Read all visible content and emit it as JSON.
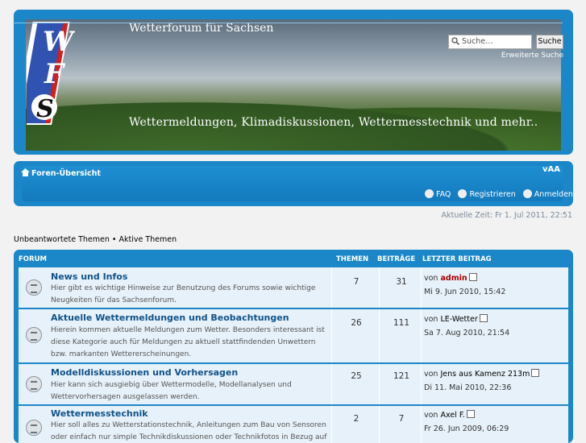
{
  "header": {
    "forum_title": "Wetterforum für Sachsen",
    "tagline": "Wettermeldungen, Klimadiskussionen, Wettermesstechnik und mehr..",
    "search_placeholder": "Suche…",
    "search_button": "Suche",
    "advanced_search": "Erweiterte Suche",
    "logo_letters": "WFS"
  },
  "nav": {
    "forum_index": "Foren-Übersicht",
    "font_size_toggle": "vAA",
    "faq": "FAQ",
    "register": "Registrieren",
    "login": "Anmelden"
  },
  "time": "Aktuelle Zeit: Fr 1. Jul 2011, 22:51",
  "quicklinks": "Unbeantwortete Themen • Aktive Themen",
  "table": {
    "headers": {
      "forum": "FORUM",
      "topics": "THEMEN",
      "posts": "BEITRÄGE",
      "last_post": "LETZTER BEITRAG"
    },
    "rows": [
      {
        "title": "News und Infos",
        "desc": "Hier gibt es wichtige Hinweise zur Benutzung des Forums sowie wichtige Neugkeiten für das Sachsenforum.",
        "topics": "7",
        "posts": "31",
        "by": "von",
        "author": "admin",
        "date": "Mi 9. Jun 2010, 15:42"
      },
      {
        "title": "Aktuelle Wettermeldungen und Beobachtungen",
        "desc": "Hierein kommen aktuelle Meldungen zum Wetter. Besonders interessant ist diese Kategorie auch für Meldungen zu aktuell stattfindenden Unwettern bzw. markanten Wettererscheinungen.",
        "topics": "26",
        "posts": "111",
        "by": "von",
        "author": "LE-Wetter",
        "date": "Sa 7. Aug 2010, 21:54"
      },
      {
        "title": "Modelldiskussionen und Vorhersagen",
        "desc": "Hier kann sich ausgiebig über Wettermodelle, Modellanalysen und Wettervorhersagen ausgelassen werden.",
        "topics": "25",
        "posts": "121",
        "by": "von",
        "author": "Jens aus Kamenz 213m",
        "date": "Di 11. Mai 2010, 22:36"
      },
      {
        "title": "Wettermesstechnik",
        "desc": "Hier soll alles zu Wetterstationstechnik, Anleitungen zum Bau von Sensoren oder einfach nur simple Technikdiskussionen oder Technikfotos in Bezug auf",
        "topics": "2",
        "posts": "7",
        "by": "von",
        "author": "Axel F.",
        "date": "Fr 26. Jun 2009, 06:29"
      }
    ]
  }
}
